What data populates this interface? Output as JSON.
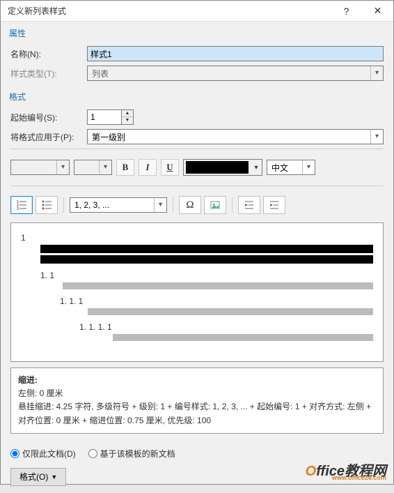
{
  "titlebar": {
    "title": "定义新列表样式",
    "help": "?",
    "close": "✕"
  },
  "sections": {
    "properties": "属性",
    "format": "格式"
  },
  "props": {
    "name_label": "名称(N):",
    "name_value": "样式1",
    "type_label": "样式类型(T):",
    "type_value": "列表"
  },
  "fmt": {
    "start_label": "起始编号(S):",
    "start_value": "1",
    "apply_label": "将格式应用于(P):",
    "apply_value": "第一级别"
  },
  "toolbar1": {
    "bold": "B",
    "italic": "I",
    "underline": "U",
    "lang": "中文"
  },
  "toolbar2": {
    "num_format": "1, 2, 3, ..."
  },
  "preview": {
    "l1": "1",
    "l2": "1. 1",
    "l3": "1. 1. 1",
    "l4": "1. 1. 1. 1"
  },
  "summary": {
    "heading": "缩进:",
    "line1": "左侧:  0 厘米",
    "line2": "悬挂缩进: 4.25 字符, 多级符号 + 级别: 1 + 编号样式: 1, 2, 3, ... + 起始编号: 1 + 对齐方式: 左侧 + 对齐位置:  0 厘米 + 缩进位置:  0.75 厘米, 优先级: 100"
  },
  "radios": {
    "r1": "仅限此文档(D)",
    "r2": "基于该模板的新文档"
  },
  "footer": {
    "format_btn": "格式(O)"
  },
  "watermark": {
    "brand1": "O",
    "brand2": "ffice教程网",
    "url": "www.office26.com"
  }
}
